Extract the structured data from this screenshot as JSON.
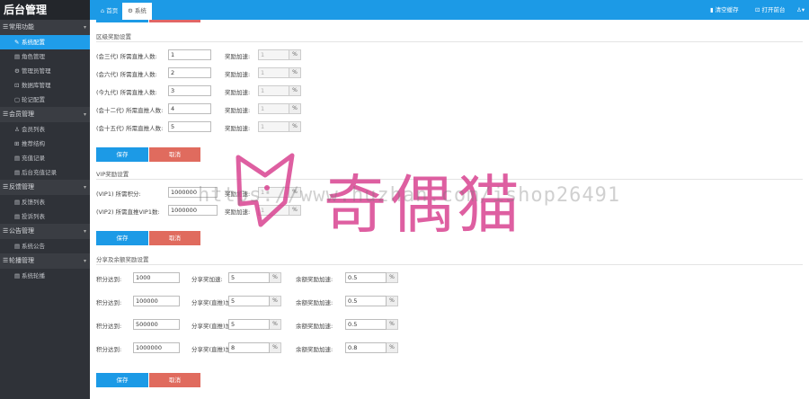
{
  "sidebar": {
    "logo": "后台管理",
    "groups": [
      {
        "label": "常用功能",
        "items": [
          {
            "label": "系统配置",
            "icon": "✎"
          },
          {
            "label": "角色管理",
            "icon": "▤"
          },
          {
            "label": "管理员管理",
            "icon": "⚙"
          },
          {
            "label": "数据库管理",
            "icon": "⊡"
          },
          {
            "label": "轮记配置",
            "icon": "▢"
          }
        ]
      },
      {
        "label": "会员管理",
        "items": [
          {
            "label": "会员列表",
            "icon": "♙"
          },
          {
            "label": "推荐结构",
            "icon": "⊞"
          },
          {
            "label": "充值记录",
            "icon": "▤"
          },
          {
            "label": "后台充值记录",
            "icon": "▤"
          }
        ]
      },
      {
        "label": "反馈管理",
        "items": [
          {
            "label": "反馈列表",
            "icon": "▤"
          },
          {
            "label": "投诉列表",
            "icon": "▤"
          }
        ]
      },
      {
        "label": "公告管理",
        "items": [
          {
            "label": "系统公告",
            "icon": "▤"
          }
        ]
      },
      {
        "label": "轮播管理",
        "items": [
          {
            "label": "系统轮播",
            "icon": "▤"
          }
        ]
      }
    ]
  },
  "topbar": {
    "tab_home": "首页",
    "tab_system": "系统",
    "clear_cache": "清空缓存",
    "open_frontend": "打开前台",
    "user_menu": "▾"
  },
  "section1": {
    "title": "区级奖励设置",
    "bonus_label": "奖励加速:",
    "unit": "%",
    "rows": [
      {
        "label": "(会三代) 所需直推人数:",
        "value": "1",
        "bonus": "1"
      },
      {
        "label": "(会六代) 所需直推人数:",
        "value": "2",
        "bonus": "1"
      },
      {
        "label": "(今九代) 所需直推人数:",
        "value": "3",
        "bonus": "1"
      },
      {
        "label": "(会十二代) 所需直推人数:",
        "value": "4",
        "bonus": "1"
      },
      {
        "label": "(会十五代) 所需直推人数:",
        "value": "5",
        "bonus": "1"
      }
    ]
  },
  "section2": {
    "title": "VIP奖励设置",
    "rows": [
      {
        "label": "(VIP1) 所需积分:",
        "value": "1000000",
        "bonus_label": "奖励加速:",
        "bonus": "1"
      },
      {
        "label": "(VIP2) 所需直推VIP1数:",
        "value": "1000000",
        "bonus_label": "奖励加速:",
        "bonus": "1"
      }
    ]
  },
  "section3": {
    "title": "分享及余额奖励设置",
    "rows": [
      {
        "reach_label": "积分达到:",
        "reach": "1000",
        "share_label": "分享奖加速:",
        "share": "5",
        "bal_label": "余额奖励加速:",
        "bal": "0.5"
      },
      {
        "reach_label": "积分达到:",
        "reach": "100000",
        "share_label": "分享奖(直推)加速:",
        "share": "5",
        "bal_label": "余额奖励加速:",
        "bal": "0.5"
      },
      {
        "reach_label": "积分达到:",
        "reach": "500000",
        "share_label": "分享奖(直推)加速:",
        "share": "5",
        "bal_label": "余额奖励加速:",
        "bal": "0.5"
      },
      {
        "reach_label": "积分达到:",
        "reach": "1000000",
        "share_label": "分享奖(直推)加速:",
        "share": "8",
        "bal_label": "余额奖励加速:",
        "bal": "0.8"
      }
    ]
  },
  "buttons": {
    "save": "保存",
    "cancel": "取消"
  },
  "watermark": {
    "url": "https://www.huzhan.com/ishop26491",
    "brand": "奇偶猫"
  },
  "colors": {
    "accent": "#1c9ae6",
    "danger": "#e06b5e",
    "sidebar": "#2f3238",
    "watermark": "#d73c8c"
  }
}
